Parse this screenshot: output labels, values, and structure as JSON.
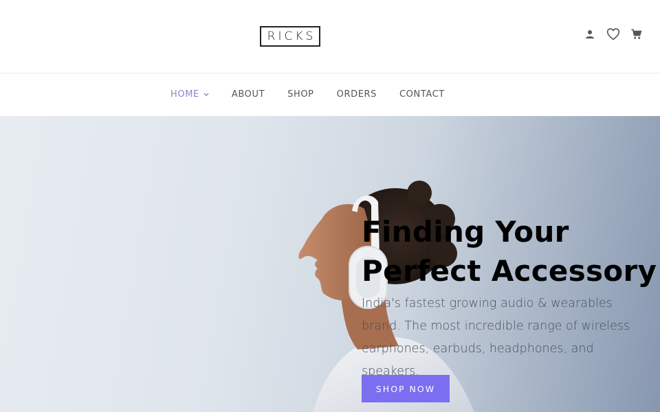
{
  "brand": {
    "logo_text": "RICKS"
  },
  "header": {
    "icons": [
      "user-icon",
      "heart-icon",
      "cart-icon"
    ]
  },
  "nav": {
    "items": [
      {
        "label": "HOME",
        "active": true,
        "has_dropdown": true
      },
      {
        "label": "ABOUT"
      },
      {
        "label": "SHOP"
      },
      {
        "label": "ORDERS"
      },
      {
        "label": "CONTACT"
      }
    ]
  },
  "hero": {
    "title_line1": "Finding Your",
    "title_line2": "Perfect Accessory",
    "description": "India's fastest growing audio & wearables brand. The most incredible range of wireless earphones, earbuds, headphones, and speakers.",
    "cta_label": "SHOP NOW"
  },
  "colors": {
    "accent": "#7b6ef0",
    "nav_active": "#8b84c8",
    "hero_bg_light": "#e7ecf1",
    "hero_bg_dark": "#8797b0"
  }
}
